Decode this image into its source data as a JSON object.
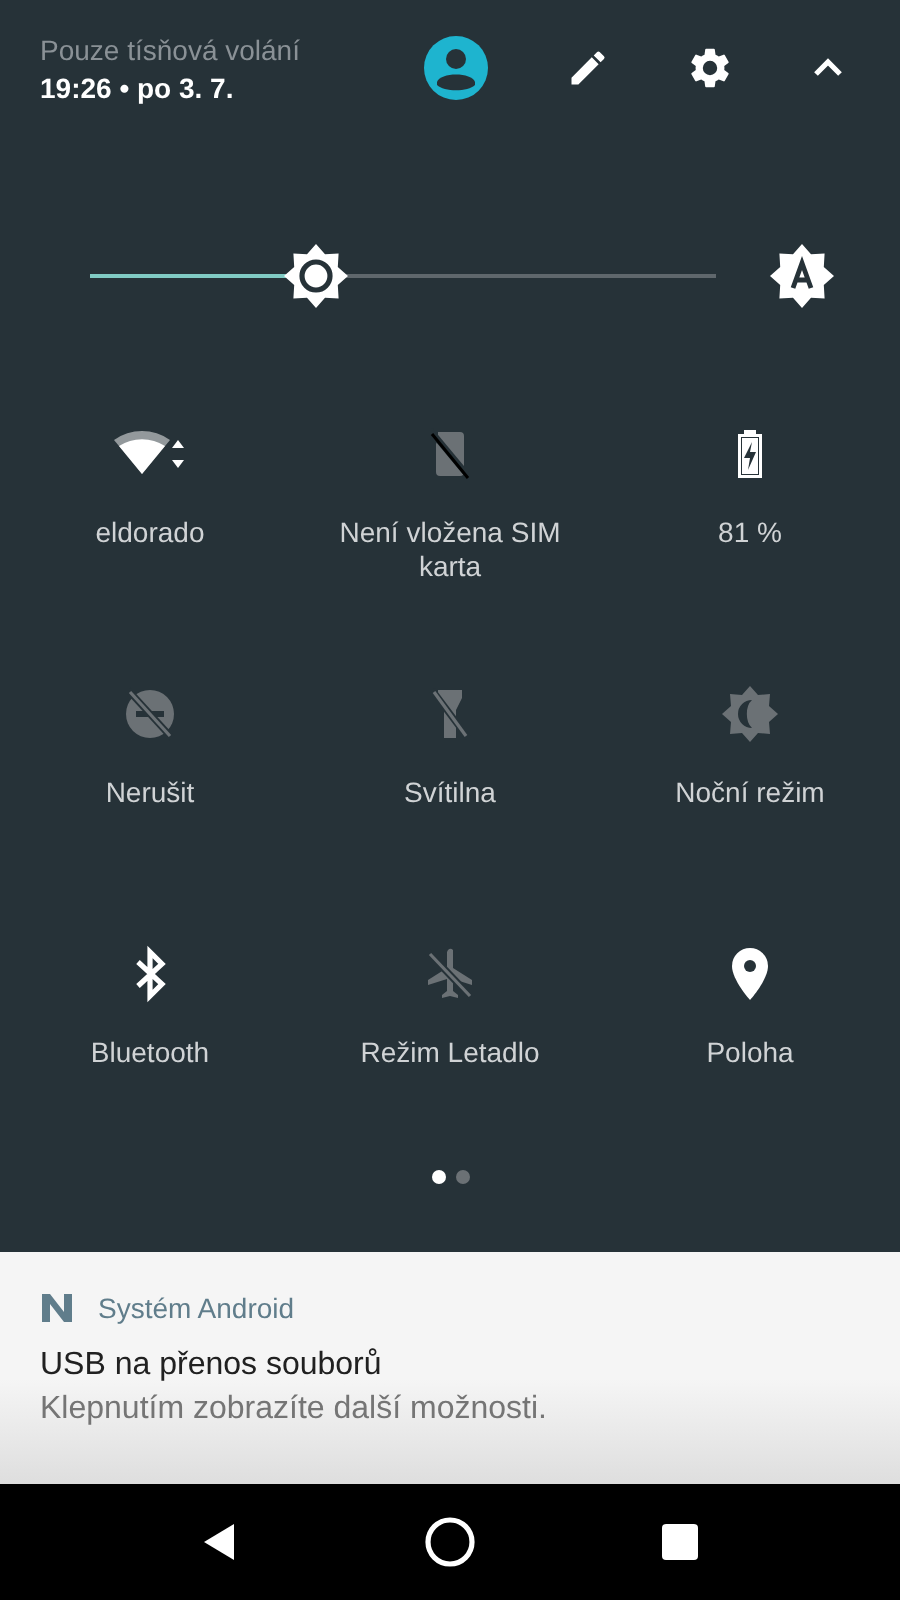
{
  "header": {
    "status": "Pouze tísňová volání",
    "datetime": "19:26 • po 3. 7."
  },
  "brightness": {
    "level": 0.36,
    "auto": true
  },
  "tiles": [
    {
      "kind": "wifi",
      "label": "eldorado",
      "on": true
    },
    {
      "kind": "sim",
      "label": "Není vložena SIM karta",
      "on": false
    },
    {
      "kind": "battery",
      "label": "81 %",
      "on": true
    },
    {
      "kind": "dnd",
      "label": "Nerušit",
      "on": false
    },
    {
      "kind": "flashlight",
      "label": "Svítilna",
      "on": false
    },
    {
      "kind": "night",
      "label": "Noční režim",
      "on": false
    },
    {
      "kind": "bluetooth",
      "label": "Bluetooth",
      "on": true
    },
    {
      "kind": "airplane",
      "label": "Režim Letadlo",
      "on": false
    },
    {
      "kind": "location",
      "label": "Poloha",
      "on": true
    }
  ],
  "pages": [
    {
      "selected": true
    },
    {
      "selected": false
    }
  ],
  "notification": {
    "app": "Systém Android",
    "title": "USB na přenos souborů",
    "text": "Klepnutím zobrazíte další možnosti."
  }
}
